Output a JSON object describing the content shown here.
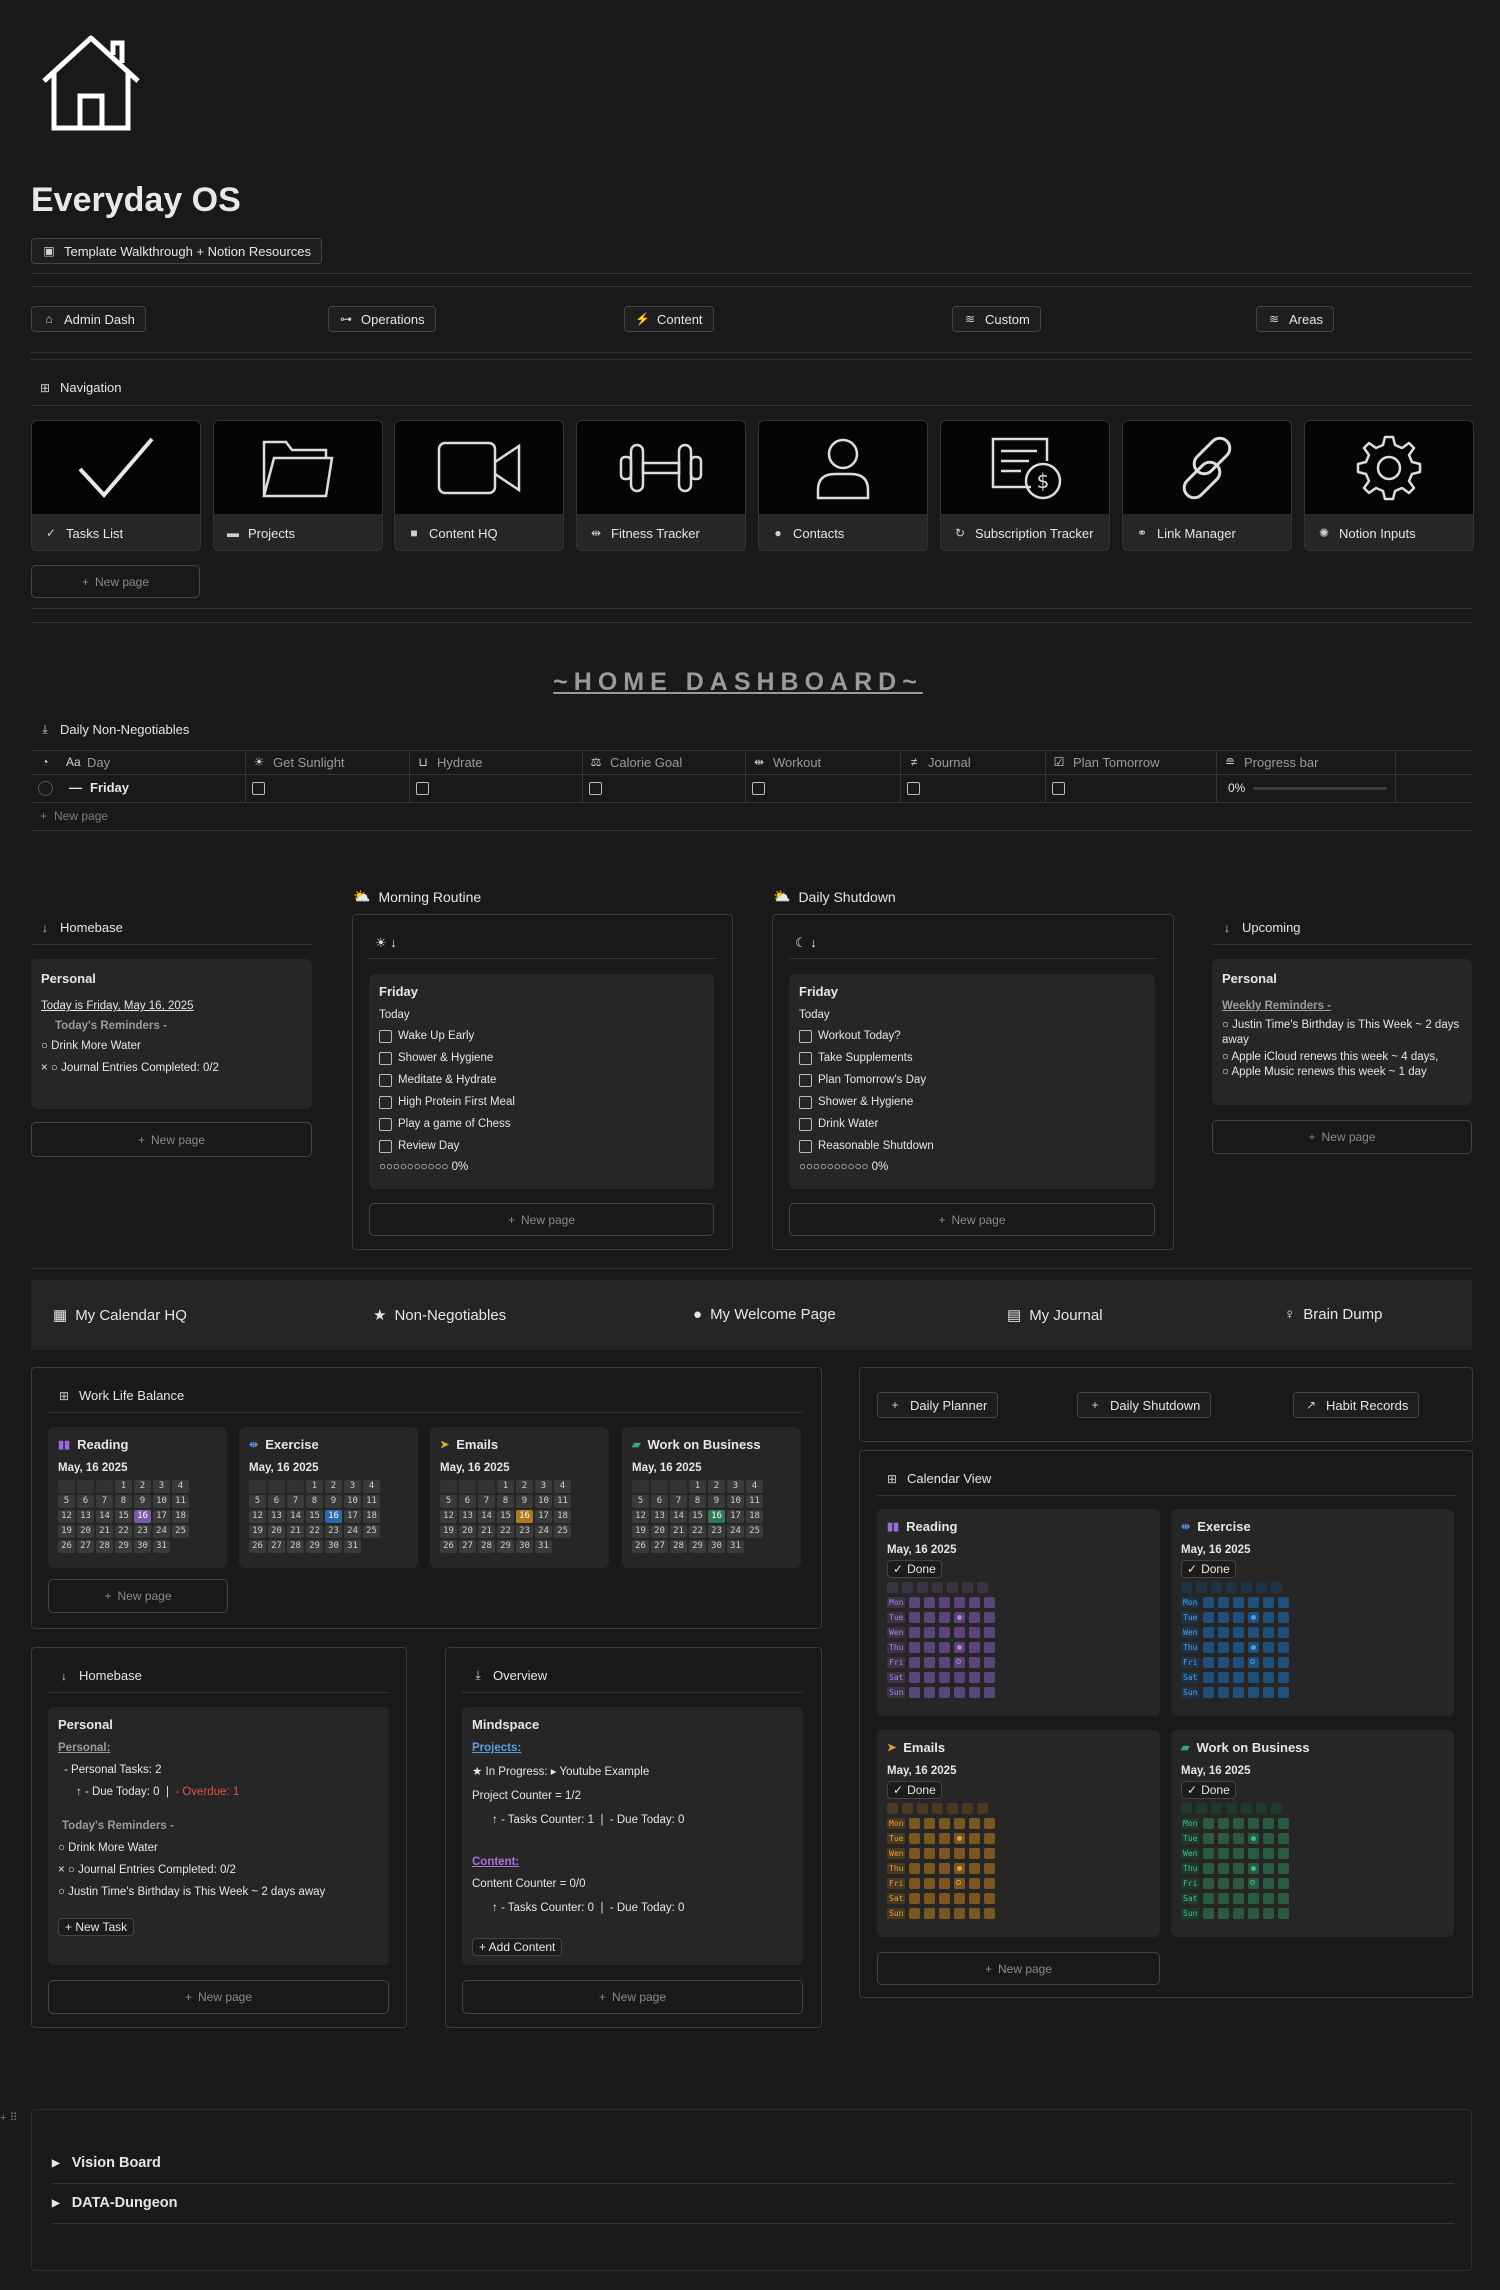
{
  "page": {
    "title": "Everyday OS",
    "walkthrough": "Template Walkthrough + Notion Resources"
  },
  "topnav": [
    "Admin Dash",
    "Operations",
    "Content",
    "Custom",
    "Areas"
  ],
  "navigation": {
    "heading": "Navigation",
    "items": [
      "Tasks List",
      "Projects",
      "Content HQ",
      "Fitness Tracker",
      "Contacts",
      "Subscription Tracker",
      "Link Manager",
      "Notion Inputs"
    ],
    "new_page": "New page"
  },
  "dashboard_title": "~HOME DASHBOARD~",
  "nonneg": {
    "heading": "Daily Non-Negotiables",
    "cols": [
      "Day",
      "Get Sunlight",
      "Hydrate",
      "Calorie Goal",
      "Workout",
      "Journal",
      "Plan Tomorrow",
      "Progress bar"
    ],
    "row_day": "Friday",
    "row_progress": "0%",
    "new_page": "New page"
  },
  "homebase1": {
    "heading": "Homebase",
    "card_title": "Personal",
    "today": "Today is Friday, May 16, 2025",
    "reminders": "Today's Reminders -",
    "items": [
      "Drink More Water",
      "Journal Entries Completed: 0/2"
    ],
    "new_page": "New page"
  },
  "morning": {
    "heading": "Morning Routine",
    "card_title": "Friday",
    "today": "Today",
    "items": [
      "Wake Up Early",
      "Shower & Hygiene",
      "Meditate & Hydrate",
      "High Protein First Meal",
      "Play a game of Chess",
      "Review Day"
    ],
    "progress": "0%",
    "new_page": "New page"
  },
  "shutdown": {
    "heading": "Daily Shutdown",
    "card_title": "Friday",
    "today": "Today",
    "items": [
      "Workout Today?",
      "Take Supplements",
      "Plan Tomorrow's Day",
      "Shower & Hygiene",
      "Drink Water",
      "Reasonable Shutdown"
    ],
    "progress": "0%",
    "new_page": "New page"
  },
  "upcoming": {
    "heading": "Upcoming",
    "card_title": "Personal",
    "weekly": "Weekly Reminders -",
    "items": [
      "Justin Time's Birthday is This Week ~ 2 days away",
      "Apple iCloud renews this week ~ 4 days,",
      "Apple Music renews this week ~ 1 day"
    ],
    "new_page": "New page"
  },
  "linkbar": [
    "My Calendar HQ",
    "Non-Negotiables",
    "My Welcome Page",
    "My Journal",
    "Brain Dump"
  ],
  "wlb": {
    "heading": "Work Life Balance",
    "date": "May, 16 2025",
    "cards": [
      "Reading",
      "Exercise",
      "Emails",
      "Work on Business"
    ],
    "new_page": "New page"
  },
  "actions": [
    "Daily Planner",
    "Daily Shutdown",
    "Habit Records"
  ],
  "calview": {
    "heading": "Calendar View",
    "date": "May, 16 2025",
    "done": "Done",
    "cards": [
      "Reading",
      "Exercise",
      "Emails",
      "Work on Business"
    ],
    "days": [
      "Mon",
      "Tue",
      "Wen",
      "Thu",
      "Fri",
      "Sat",
      "Sun"
    ],
    "new_page": "New page"
  },
  "homebase2": {
    "heading": "Homebase",
    "card_title": "Personal",
    "personal_label": "Personal:",
    "tasks": "- Personal Tasks:  2",
    "due": "- Due Today: 0",
    "sep": "|",
    "overdue": "- Overdue: 1",
    "reminders": "Today's Reminders -",
    "items": [
      "Drink More Water",
      "Journal Entries Completed: 0/2",
      "Justin Time's Birthday is This Week ~ 2 days away"
    ],
    "button": "+ New Task",
    "new_page": "New page"
  },
  "overview": {
    "heading": "Overview",
    "card_title": "Mindspace",
    "projects_label": "Projects:",
    "in_progress": "In Progress:",
    "in_progress_val": "Youtube Example",
    "project_counter": "Project Counter = 1/2",
    "p_tasks": "- Tasks Counter: 1",
    "p_due": "- Due Today: 0",
    "sep": "|",
    "content_label": "Content:",
    "content_counter": "Content Counter = 0/0",
    "c_tasks": "- Tasks Counter: 0",
    "c_due": "- Due Today: 0",
    "button": "+ Add Content",
    "new_page": "New page"
  },
  "toggles": [
    "Vision Board",
    "DATA-Dungeon"
  ]
}
